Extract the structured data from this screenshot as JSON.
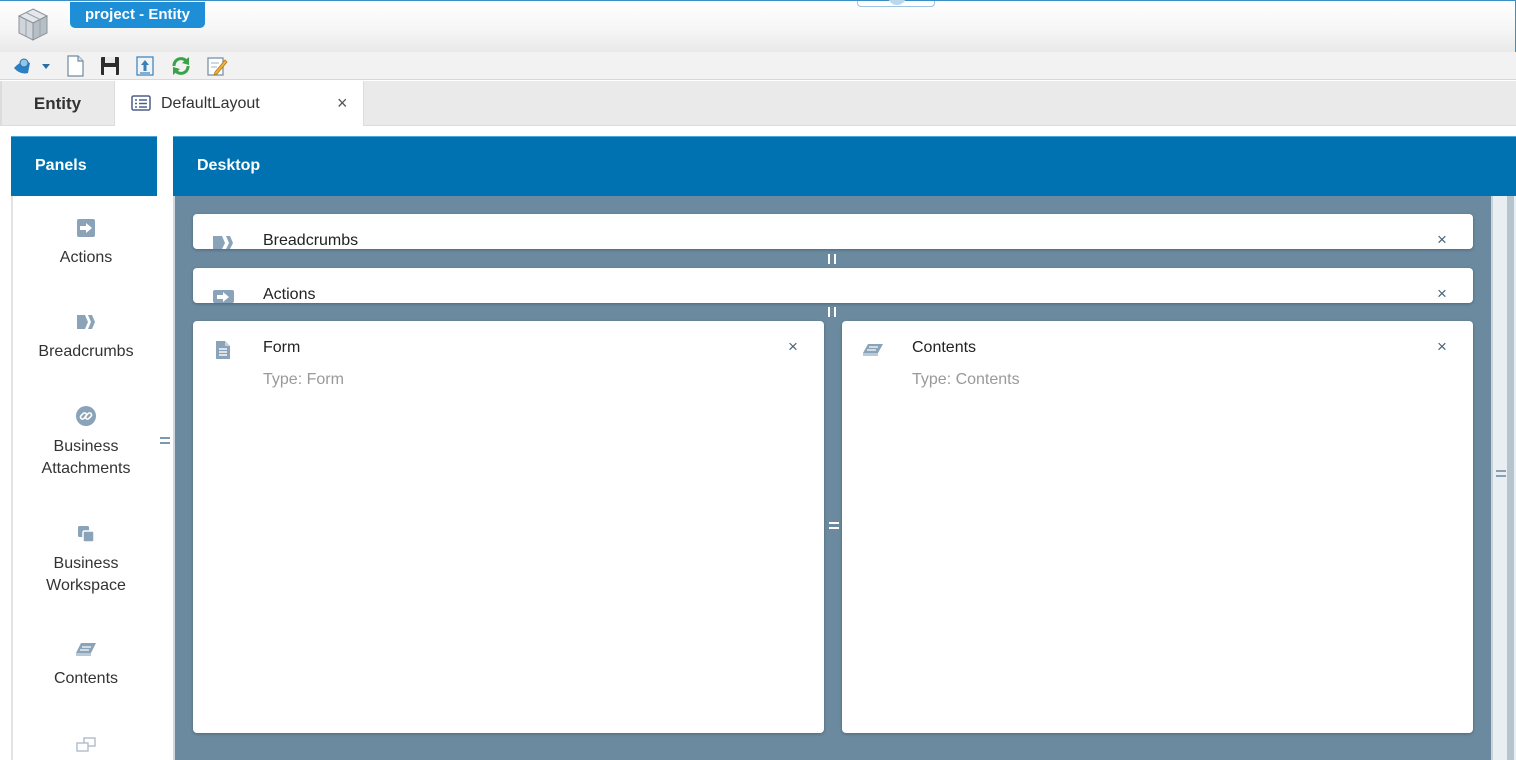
{
  "window": {
    "title": "project - Entity"
  },
  "toolbar": {
    "buttons": [
      "publish-icon",
      "new-document-icon",
      "save-icon",
      "export-icon",
      "refresh-icon",
      "edit-icon"
    ]
  },
  "tabs": [
    {
      "label": "Entity"
    },
    {
      "label": "DefaultLayout",
      "close": "×"
    }
  ],
  "panels": {
    "header": "Panels",
    "items": [
      {
        "label": "Actions",
        "icon": "arrow-right-icon"
      },
      {
        "label": "Breadcrumbs",
        "icon": "chevrons-icon"
      },
      {
        "label": "Business Attachments",
        "icon": "link-icon"
      },
      {
        "label": "Business Workspace",
        "icon": "workspace-icon"
      },
      {
        "label": "Contents",
        "icon": "book-icon"
      }
    ]
  },
  "desktop": {
    "header": "Desktop",
    "cards": [
      {
        "title": "Breadcrumbs",
        "close": "×"
      },
      {
        "title": "Actions",
        "close": "×"
      },
      {
        "title": "Form",
        "subtitle": "Type: Form",
        "close": "×"
      },
      {
        "title": "Contents",
        "subtitle": "Type: Contents",
        "close": "×"
      }
    ]
  },
  "colors": {
    "accent": "#0072b1",
    "title_pill": "#1e8fd6",
    "canvas": "#6b8aa0",
    "icon_grey": "#8aa3b8"
  }
}
